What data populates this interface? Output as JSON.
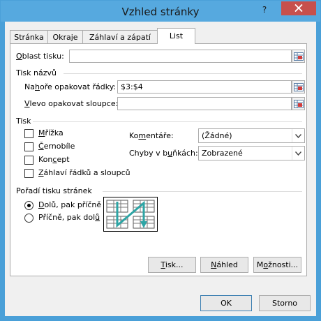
{
  "window": {
    "title": "Vzhled stránky",
    "help_glyph": "?",
    "close_icon": "close-icon",
    "colors": {
      "titlebar": "#56a9df",
      "close": "#c7504c",
      "accent_arrow": "#2ea5a5"
    }
  },
  "tabs": [
    {
      "label": "Stránka",
      "active": false
    },
    {
      "label": "Okraje",
      "active": false
    },
    {
      "label": "Záhlaví a zápatí",
      "active": false
    },
    {
      "label": "List",
      "active": true
    }
  ],
  "print_area": {
    "label_u": "O",
    "label_rest": "blast tisku:",
    "value": ""
  },
  "print_titles": {
    "heading": "Tisk názvů",
    "rows_label_pre": "Na",
    "rows_label_u": "h",
    "rows_label_post": "oře opakovat řádky:",
    "rows_value": "$3:$4",
    "cols_label_u": "V",
    "cols_label_post": "levo opakovat sloupce:",
    "cols_value": ""
  },
  "print": {
    "heading": "Tisk",
    "checkboxes": [
      {
        "u": "M",
        "rest": "řížka",
        "checked": false
      },
      {
        "u": "Č",
        "rest": "ernobíle",
        "checked": false
      },
      {
        "pre": "Kon",
        "u": "c",
        "rest": "ept",
        "checked": false
      },
      {
        "u": "Z",
        "rest": "áhlaví řádků a sloupců",
        "checked": false
      }
    ],
    "comments_label_pre": "Ko",
    "comments_label_u": "m",
    "comments_label_post": "entáře:",
    "comments_value": "(Žádné)",
    "errors_label_pre": "Chyby v b",
    "errors_label_u": "u",
    "errors_label_post": "ňkách:",
    "errors_value": "Zobrazené"
  },
  "page_order": {
    "heading": "Pořadí tisku stránek",
    "options": [
      {
        "u": "D",
        "rest": "olů, pak příčně",
        "selected": true
      },
      {
        "pre": "Příčně, pak dol",
        "u": "ů",
        "rest": "",
        "selected": false
      }
    ]
  },
  "buttons": {
    "print": {
      "u": "T",
      "rest": "isk..."
    },
    "preview": {
      "u": "N",
      "rest": "áhled"
    },
    "options": {
      "pre": "M",
      "u": "o",
      "rest": "žnosti..."
    },
    "ok": "OK",
    "cancel": "Storno"
  }
}
